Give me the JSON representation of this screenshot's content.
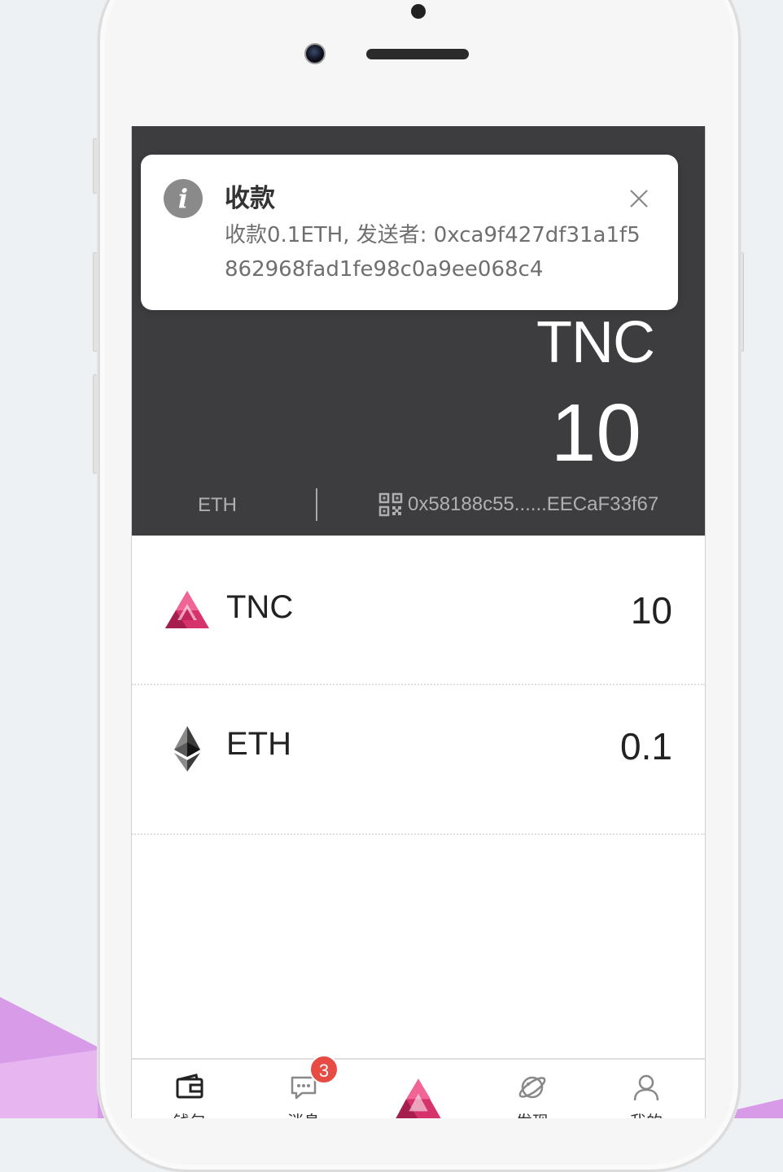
{
  "notification": {
    "title": "收款",
    "message": "收款0.1ETH, 发送者: 0xca9f427df31a1f5862968fad1fe98c0a9ee068c4"
  },
  "wallet_header": {
    "symbol": "TNC",
    "balance": "10",
    "chain": "ETH",
    "address": "0x58188c55......EECaF33f67"
  },
  "tokens": [
    {
      "name": "TNC",
      "value": "10",
      "icon": "tnc-logo-icon"
    },
    {
      "name": "ETH",
      "value": "0.1",
      "icon": "ethereum-icon"
    }
  ],
  "tabbar": {
    "wallet_label": "钱包",
    "messages_label": "消息",
    "messages_badge": "3",
    "discover_label": "发现",
    "mine_label": "我的"
  },
  "colors": {
    "header_bg": "#3d3d3f",
    "badge": "#e64c44",
    "tnc_brand": "#d6336c"
  }
}
